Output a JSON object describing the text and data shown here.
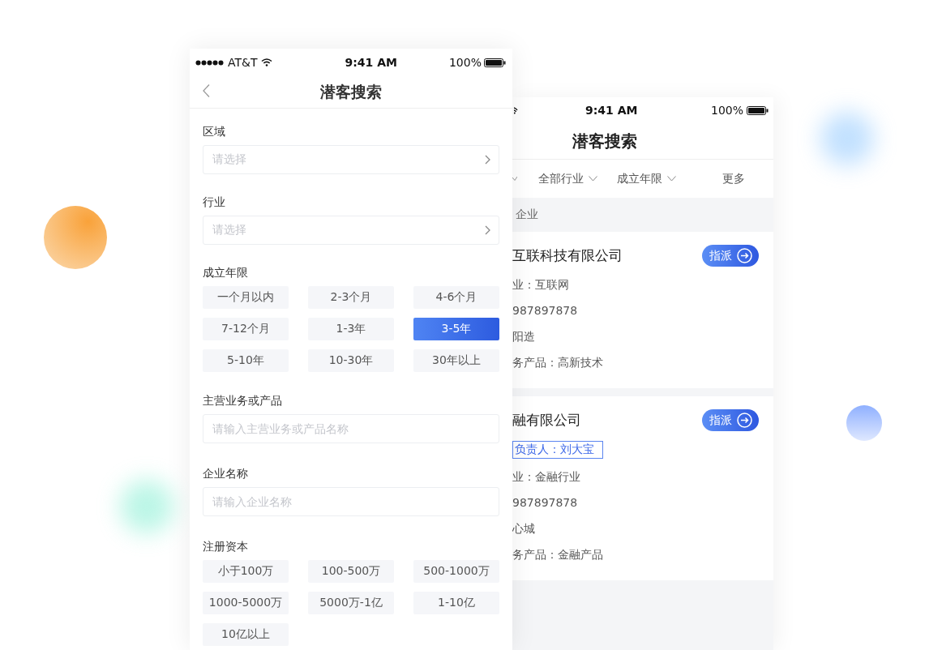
{
  "front": {
    "status_bar": {
      "carrier": "AT&T",
      "time": "9:41 AM",
      "battery": "100%"
    },
    "title": "潜客搜索",
    "fields": [
      {
        "kind": "select",
        "label": "区域",
        "placeholder": "请选择"
      },
      {
        "kind": "select",
        "label": "行业",
        "placeholder": "请选择"
      },
      {
        "kind": "chips",
        "label": "成立年限",
        "options": [
          {
            "label": "一个月以内",
            "selected": false
          },
          {
            "label": "2-3个月",
            "selected": false
          },
          {
            "label": "4-6个月",
            "selected": false
          },
          {
            "label": "7-12个月",
            "selected": false
          },
          {
            "label": "1-3年",
            "selected": false
          },
          {
            "label": "3-5年",
            "selected": true
          },
          {
            "label": "5-10年",
            "selected": false
          },
          {
            "label": "10-30年",
            "selected": false
          },
          {
            "label": "30年以上",
            "selected": false
          }
        ]
      },
      {
        "kind": "input",
        "label": "主营业务或产品",
        "placeholder": "请输入主营业务或产品名称"
      },
      {
        "kind": "input",
        "label": "企业名称",
        "placeholder": "请输入企业名称"
      },
      {
        "kind": "chips",
        "label": "注册资本",
        "options": [
          {
            "label": "小于100万",
            "selected": false
          },
          {
            "label": "100-500万",
            "selected": false
          },
          {
            "label": "500-1000万",
            "selected": false
          },
          {
            "label": "1000-5000万",
            "selected": false
          },
          {
            "label": "5000万-1亿",
            "selected": false
          },
          {
            "label": "1-10亿",
            "selected": false
          },
          {
            "label": "10亿以上",
            "selected": false
          }
        ]
      }
    ]
  },
  "back": {
    "status_bar": {
      "time": "9:41 AM",
      "battery": "100%"
    },
    "title": "潜客搜索",
    "filters": [
      {
        "kind": "dropdown",
        "label": "全部行业"
      },
      {
        "kind": "dropdown",
        "label": "成立年限"
      },
      {
        "kind": "plain",
        "label": "更多"
      }
    ],
    "section_title": "企业",
    "companies": [
      {
        "name": "互联科技有限公司",
        "action": "指派",
        "details": [
          "业：互联网",
          "987897878",
          "阳造",
          "务产品：高新技术"
        ]
      },
      {
        "name": "融有限公司",
        "action": "指派",
        "owner_tag": "负责人：刘大宝",
        "details": [
          "业：金融行业",
          "987897878",
          "心城",
          "务产品：金融产品"
        ]
      }
    ]
  }
}
